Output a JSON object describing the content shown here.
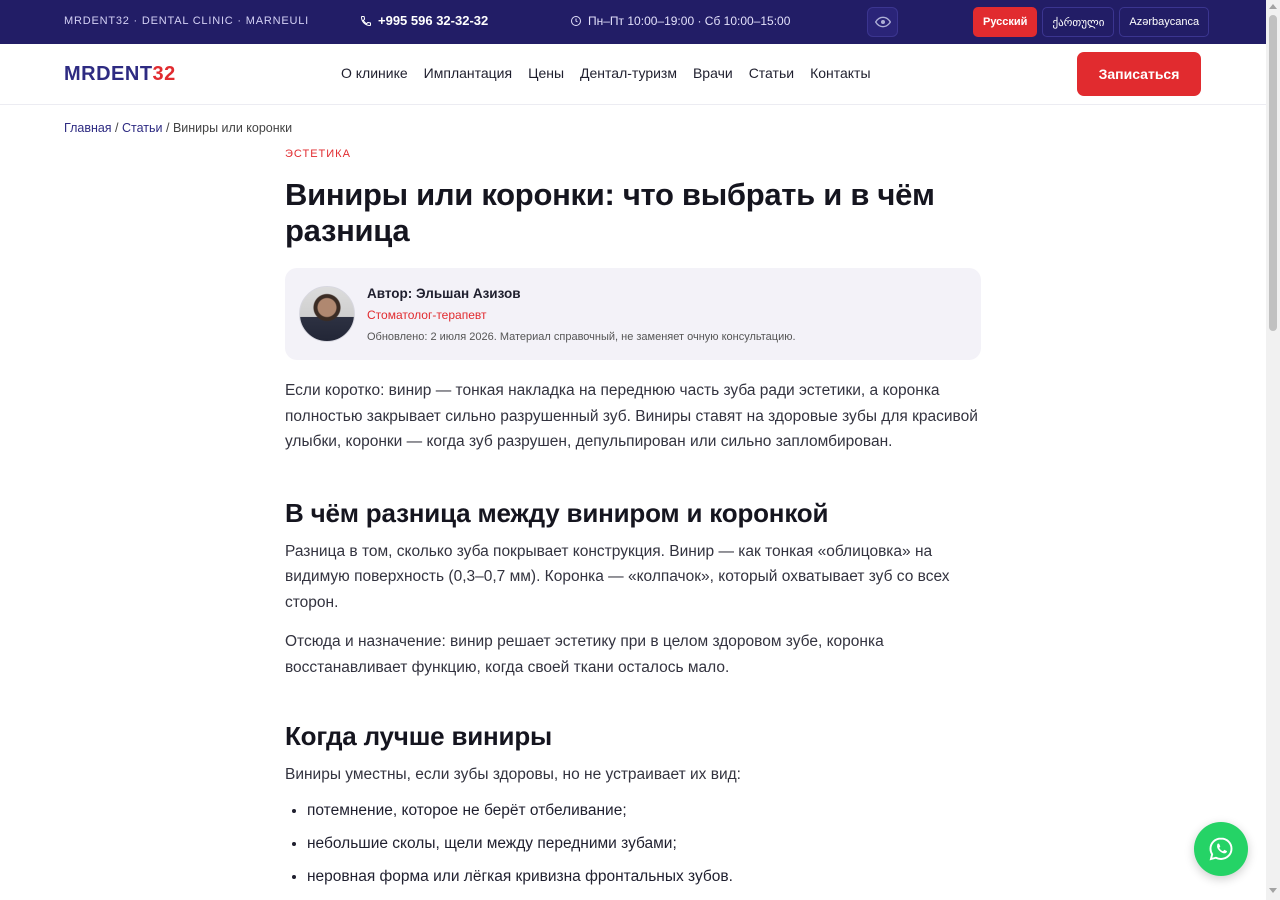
{
  "topbar": {
    "brand_line": "MRDENT32 · DENTAL CLINIC · MARNEULI",
    "phone": "+995 596 32-32-32",
    "hours": "Пн–Пт 10:00–19:00 · Сб 10:00–15:00",
    "accessibility_icon": "eye-icon",
    "languages": [
      {
        "label": "Русский",
        "active": true
      },
      {
        "label": "ქართული",
        "active": false
      },
      {
        "label": "Azərbaycanca",
        "active": false
      }
    ]
  },
  "header": {
    "logo_part1": "MRDENT",
    "logo_part2": "32",
    "nav": [
      "О клинике",
      "Имплантация",
      "Цены",
      "Дентал-туризм",
      "Врачи",
      "Статьи",
      "Контакты"
    ],
    "cta": "Записаться"
  },
  "breadcrumb": {
    "home": "Главная",
    "sep1": " / ",
    "articles": "Статьи",
    "sep2": " / ",
    "current": "Виниры или коронки"
  },
  "article": {
    "category": "ЭСТЕТИКА",
    "title": "Виниры или коронки: что выбрать и в чём разница",
    "author": {
      "name": "Автор: Эльшан Азизов",
      "role": "Стоматолог-терапевт",
      "meta": "Обновлено: 2 июля 2026. Материал справочный, не заменяет очную консультацию."
    },
    "lead": "Если коротко: винир — тонкая накладка на переднюю часть зуба ради эстетики, а коронка полностью закрывает сильно разрушенный зуб. Виниры ставят на здоровые зубы для красивой улыбки, коронки — когда зуб разрушен, депульпирован или сильно запломбирован.",
    "section1": {
      "heading": "В чём разница между виниром и коронкой",
      "p1": "Разница в том, сколько зуба покрывает конструкция. Винир — как тонкая «облицовка» на видимую поверхность (0,3–0,7 мм). Коронка — «колпачок», который охватывает зуб со всех сторон.",
      "p2": "Отсюда и назначение: винир решает эстетику при в целом здоровом зубе, коронка восстанавливает функцию, когда своей ткани осталось мало."
    },
    "section2": {
      "heading": "Когда лучше виниры",
      "intro": "Виниры уместны, если зубы здоровы, но не устраивает их вид:",
      "items": [
        "потемнение, которое не берёт отбеливание;",
        "небольшие сколы, щели между передними зубами;",
        "неровная форма или лёгкая кривизна фронтальных зубов."
      ]
    }
  },
  "floating": {
    "icon": "whatsapp-icon"
  },
  "colors": {
    "topbar_bg": "#221d66",
    "accent_red": "#e12b2f",
    "brand_indigo": "#2e2b82",
    "whatsapp_green": "#25d366"
  }
}
